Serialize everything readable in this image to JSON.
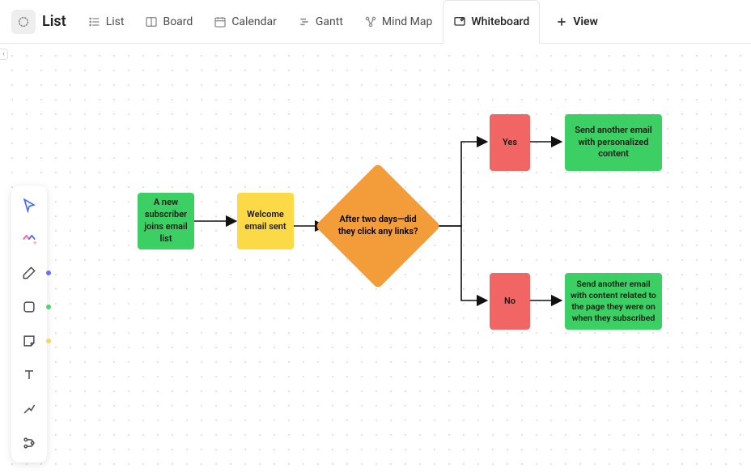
{
  "title": "List",
  "tabs": {
    "list": "List",
    "board": "Board",
    "calendar": "Calendar",
    "gantt": "Gantt",
    "mindmap": "Mind Map",
    "whiteboard": "Whiteboard",
    "addView": "View"
  },
  "toolbar": {
    "cursor_dot": "#6b6bff",
    "shape_dot": "#4fd56a",
    "sticky_dot": "#f8d664"
  },
  "flow": {
    "start": "A new subscriber joins email list",
    "welcome": "Welcome email sent",
    "decision": "After two days—did they click any links?",
    "yes": "Yes",
    "no": "No",
    "yesAction": "Send another email with personalized content",
    "noAction": "Send another email with content related to the page they were on when they subscribed"
  }
}
